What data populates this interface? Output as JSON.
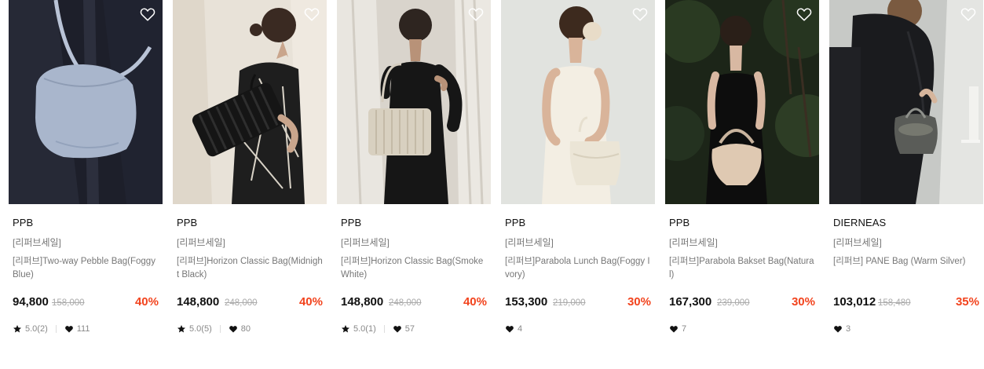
{
  "products": [
    {
      "brand": "PPB",
      "tag": "[리퍼브세일]",
      "name": "[리퍼브]Two-way Pebble Bag(Foggy Blue)",
      "price": "94,800",
      "original": "158,000",
      "discount": "40%",
      "rating": "5.0(2)",
      "likes": "111",
      "image": "woman-with-blue-crossbody-bag"
    },
    {
      "brand": "PPB",
      "tag": "[리퍼브세일]",
      "name": "[리퍼브]Horizon Classic Bag(Midnight Black)",
      "price": "148,800",
      "original": "248,000",
      "discount": "40%",
      "rating": "5.0(5)",
      "likes": "80",
      "image": "woman-with-black-quilted-shoulder-bag"
    },
    {
      "brand": "PPB",
      "tag": "[리퍼브세일]",
      "name": "[리퍼브]Horizon Classic Bag(Smoke White)",
      "price": "148,800",
      "original": "248,000",
      "discount": "40%",
      "rating": "5.0(1)",
      "likes": "57",
      "image": "woman-with-white-quilted-shoulder-bag"
    },
    {
      "brand": "PPB",
      "tag": "[리퍼브세일]",
      "name": "[리퍼브]Parabola Lunch Bag(Foggy Ivory)",
      "price": "153,300",
      "original": "219,000",
      "discount": "30%",
      "rating": "",
      "likes": "4",
      "image": "woman-in-white-dress-with-ivory-bag"
    },
    {
      "brand": "PPB",
      "tag": "[리퍼브세일]",
      "name": "[리퍼브]Parabola Bakset Bag(Natural)",
      "price": "167,300",
      "original": "239,000",
      "discount": "30%",
      "rating": "",
      "likes": "7",
      "image": "woman-in-black-dress-with-beige-basket-bag"
    },
    {
      "brand": "DIERNEAS",
      "tag": "[리퍼브세일]",
      "name": "[리퍼브] PANE Bag (Warm Silver)",
      "price": "103,012",
      "original": "158,480",
      "discount": "35%",
      "rating": "",
      "likes": "3",
      "image": "woman-with-silver-handbag"
    }
  ],
  "colors": {
    "discount": "#f2431d",
    "text": "#111111",
    "muted": "#777777"
  },
  "icons": {
    "wishlist": "heart-outline-icon",
    "rating": "star-icon",
    "likes": "heart-icon"
  }
}
